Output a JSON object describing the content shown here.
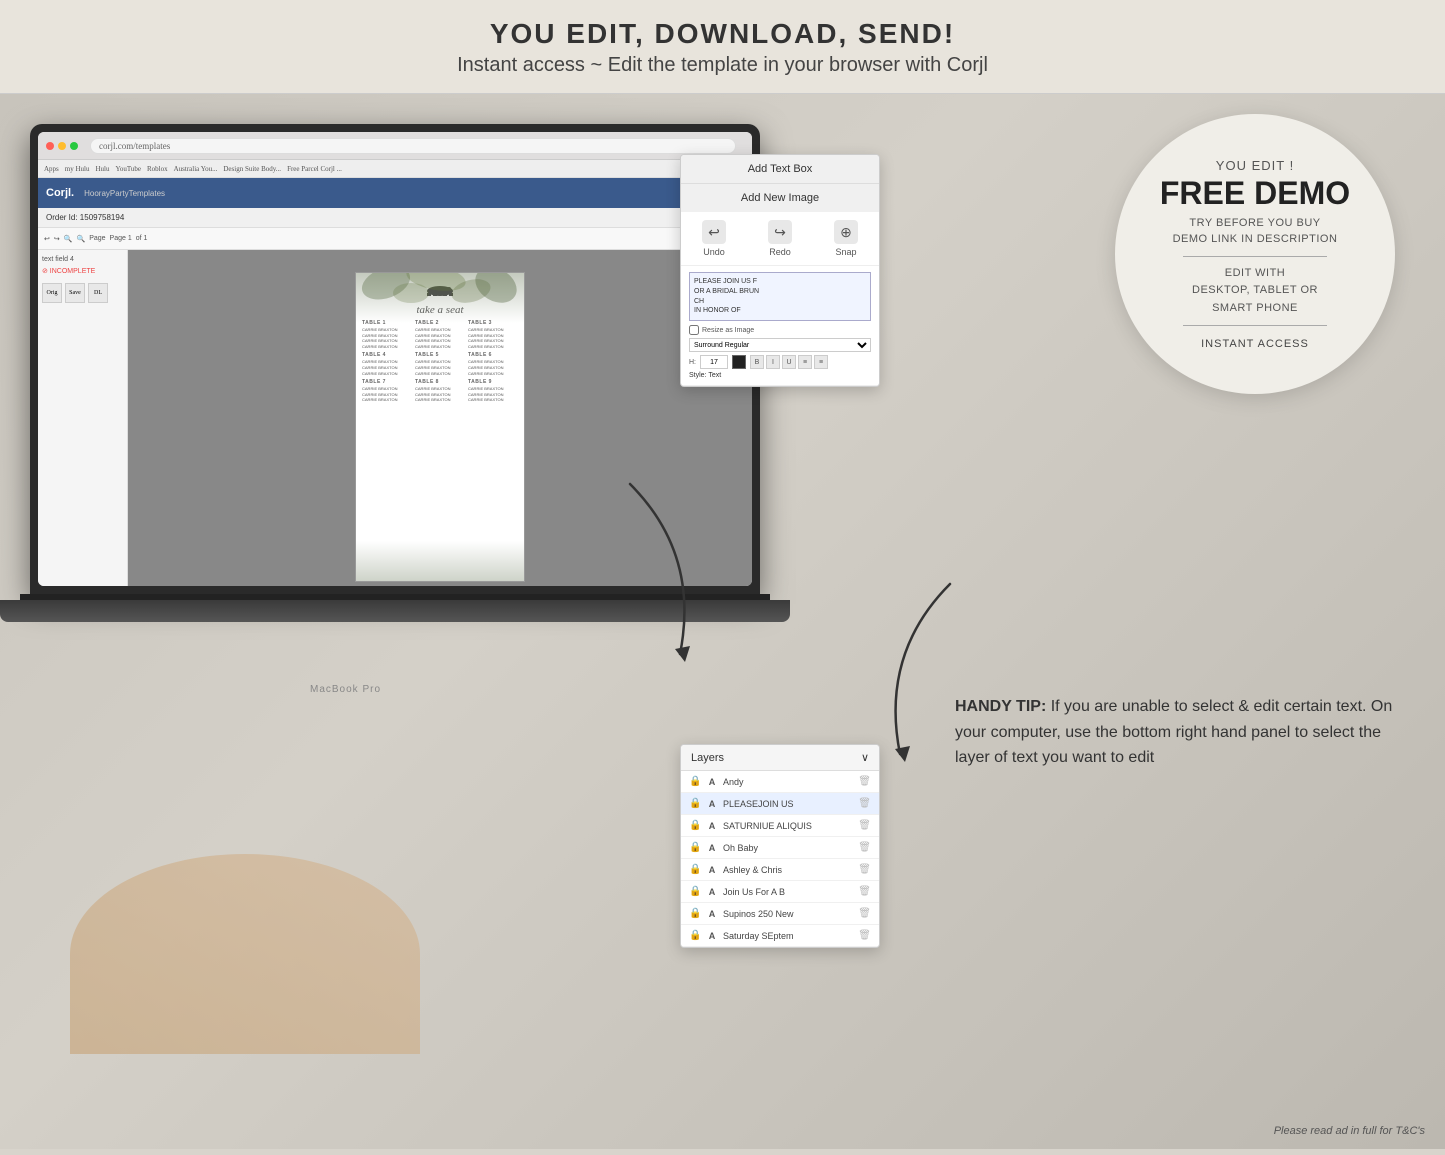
{
  "top_banner": {
    "line1": "YOU EDIT, DOWNLOAD, SEND!",
    "line2": "Instant access ~ Edit the template in your browser with Corjl"
  },
  "browser": {
    "address": "corjl.com/templates",
    "bookmarks": [
      "Apps",
      "my Hulu",
      "Hulu",
      "Youtube",
      "Roblox",
      "Australia You...",
      "Design Suite...",
      "Free Parcel"
    ]
  },
  "corjl": {
    "logo": "Corjl.",
    "nav_label": "HoorayPartyTemplates",
    "order_label": "Order Id: 1509758194",
    "toolbar_items": [
      "Page 1",
      "of 1"
    ]
  },
  "seating_chart": {
    "title": "take a seat",
    "tables": [
      {
        "label": "TABLE 1",
        "names": [
          "CARRIE BRAXTON",
          "CARRIE BRAXTON",
          "CARRIE BRAXTON",
          "CARRIE BRAXTON"
        ]
      },
      {
        "label": "TABLE 2",
        "names": [
          "CARRIE BRAXTON",
          "CARRIE BRAXTON",
          "CARRIE BRAXTON",
          "CARRIE BRAXTON"
        ]
      },
      {
        "label": "TABLE 3",
        "names": [
          "CARRIE BRAXTON",
          "CARRIE BRAXTON",
          "CARRIE BRAXTON",
          "CARRIE BRAXTON"
        ]
      },
      {
        "label": "TABLE 4",
        "names": [
          "CARRIE BRAXTON",
          "CARRIE BRAXTON",
          "CARRIE BRAXTON"
        ]
      },
      {
        "label": "TABLE 5",
        "names": [
          "CARRIE BRAXTON",
          "CARRIE BRAXTON",
          "CARRIE BRAXTON"
        ]
      },
      {
        "label": "TABLE 6",
        "names": [
          "CARRIE BRAXTON",
          "CARRIE BRAXTON",
          "CARRIE BRAXTON"
        ]
      },
      {
        "label": "TABLE 7",
        "names": [
          "CARRIE BRAXTON",
          "CARRIE BRAXTON",
          "CARRIE BRAXTON"
        ]
      },
      {
        "label": "TABLE 8",
        "names": [
          "CARRIE BRAXTON",
          "CARRIE BRAXTON",
          "CARRIE BRAXTON"
        ]
      },
      {
        "label": "TABLE 9",
        "names": [
          "CARRIE BRAXTON",
          "CARRIE BRAXTON",
          "CARRIE BRAXTON"
        ]
      }
    ]
  },
  "right_panel": {
    "add_text_box_btn": "Add Text Box",
    "add_new_image_btn": "Add New Image",
    "undo_label": "Undo",
    "redo_label": "Redo",
    "snap_label": "Snap",
    "text_placeholder": "PLEASE JOIN US F\nOR A BRIDAL BRUN\nCH\nIN HONOR OF",
    "resize_label": "Resize as Image",
    "format_label": "Surround Regular",
    "size_label": "17",
    "style_label": "Style: Text"
  },
  "layers_panel": {
    "title": "Layers",
    "items": [
      {
        "name": "Andy",
        "locked": true,
        "active": false
      },
      {
        "name": "PLEASEJOIN US",
        "locked": true,
        "active": true
      },
      {
        "name": "SATURNIUE ALIQUIS",
        "locked": true,
        "active": false
      },
      {
        "name": "Oh Baby",
        "locked": true,
        "active": false
      },
      {
        "name": "Ashley & Chris",
        "locked": true,
        "active": false
      },
      {
        "name": "Join Us For A B",
        "locked": true,
        "active": false
      },
      {
        "name": "Supinos 250 New",
        "locked": true,
        "active": false
      },
      {
        "name": "Saturday SEptem",
        "locked": true,
        "active": false
      }
    ]
  },
  "free_demo": {
    "you_edit": "YOU EDIT !",
    "title": "FREE DEMO",
    "try_before": "TRY BEFORE YOU BUY",
    "demo_link": "DEMO LINK IN DESCRIPTION",
    "edit_with": "EDIT WITH\nDESKTOP, TABLET OR\nSMART PHONE",
    "instant": "INSTANT ACCESS"
  },
  "handy_tip": {
    "label": "HANDY TIP:",
    "text": "If you are unable to select & edit certain text. On your computer, use the bottom right hand panel to select the layer of text you want to edit"
  },
  "disclaimer": {
    "text": "Please read ad in full for T&C's"
  },
  "macbook_label": "MacBook Pro"
}
